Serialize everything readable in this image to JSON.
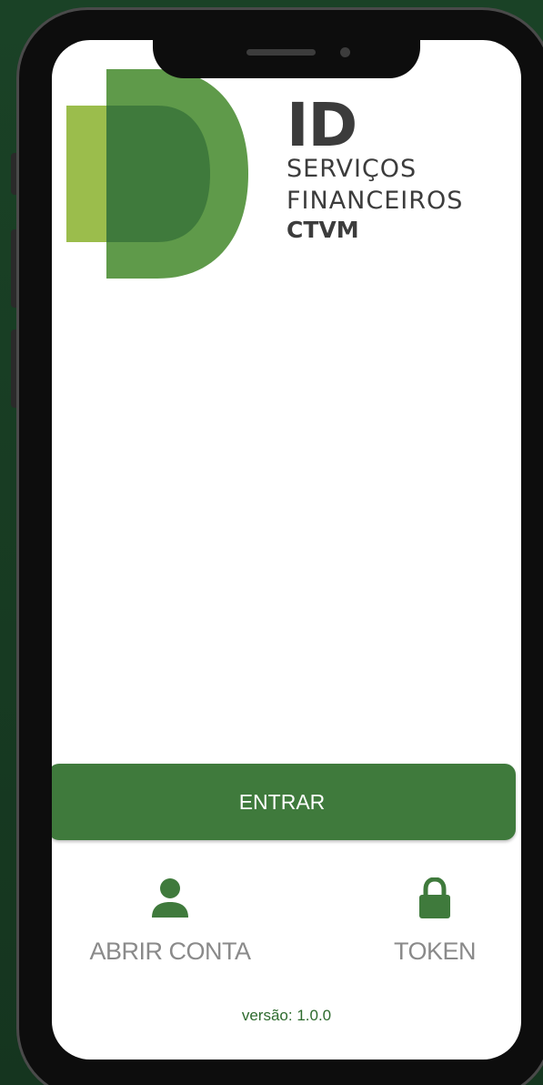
{
  "brand": {
    "logo_id": "ID",
    "logo_line1": "SERVIÇOS",
    "logo_line2": "FINANCEIROS",
    "logo_line3": "CTVM",
    "colors": {
      "dark_green": "#3f7a3c",
      "mid_green": "#5f9a4a",
      "light_green": "#9bbd4c",
      "text_gray": "#3c3c3c"
    }
  },
  "main": {
    "enter_label": "ENTRAR"
  },
  "actions": [
    {
      "label": "ABRIR CONTA",
      "icon": "user-icon"
    },
    {
      "label": "TOKEN",
      "icon": "lock-icon"
    }
  ],
  "footer": {
    "version_prefix": "versão:",
    "version_number": "1.0.0"
  },
  "accent_color": "#3f7a3c"
}
